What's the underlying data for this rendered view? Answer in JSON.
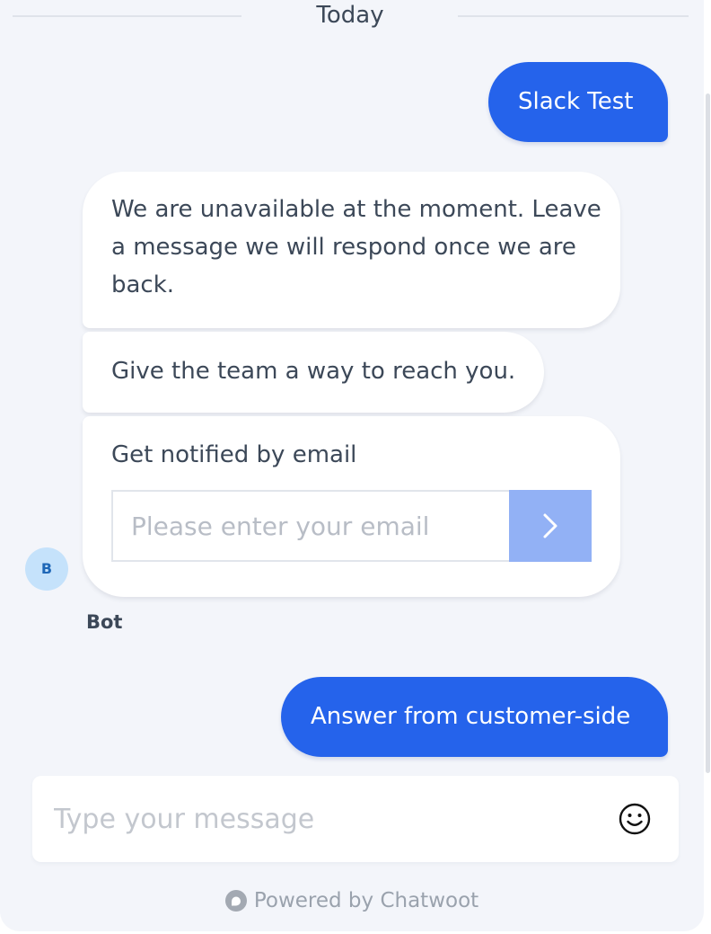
{
  "date_divider": {
    "label": "Today"
  },
  "messages": {
    "user_1": "Slack Test",
    "bot_1": "We are unavailable at the moment. Leave a message we will respond once we are back.",
    "bot_2": "Give the team a way to reach you.",
    "email_card": {
      "title": "Get notified by email",
      "input_placeholder": "Please enter your email",
      "submit_icon": "chevron-right-icon"
    },
    "user_2": "Answer from customer-side"
  },
  "sender": {
    "avatar_initial": "B",
    "name": "Bot"
  },
  "composer": {
    "placeholder": "Type your message",
    "emoji_icon": "smiley-icon"
  },
  "branding": {
    "text": "Powered by Chatwoot",
    "logo_icon": "chatwoot-logo-icon"
  },
  "colors": {
    "user_bubble": "#2563eb",
    "submit_button": "#92b1f5",
    "avatar_bg": "#c5e2fb",
    "background": "#f3f5fa"
  }
}
